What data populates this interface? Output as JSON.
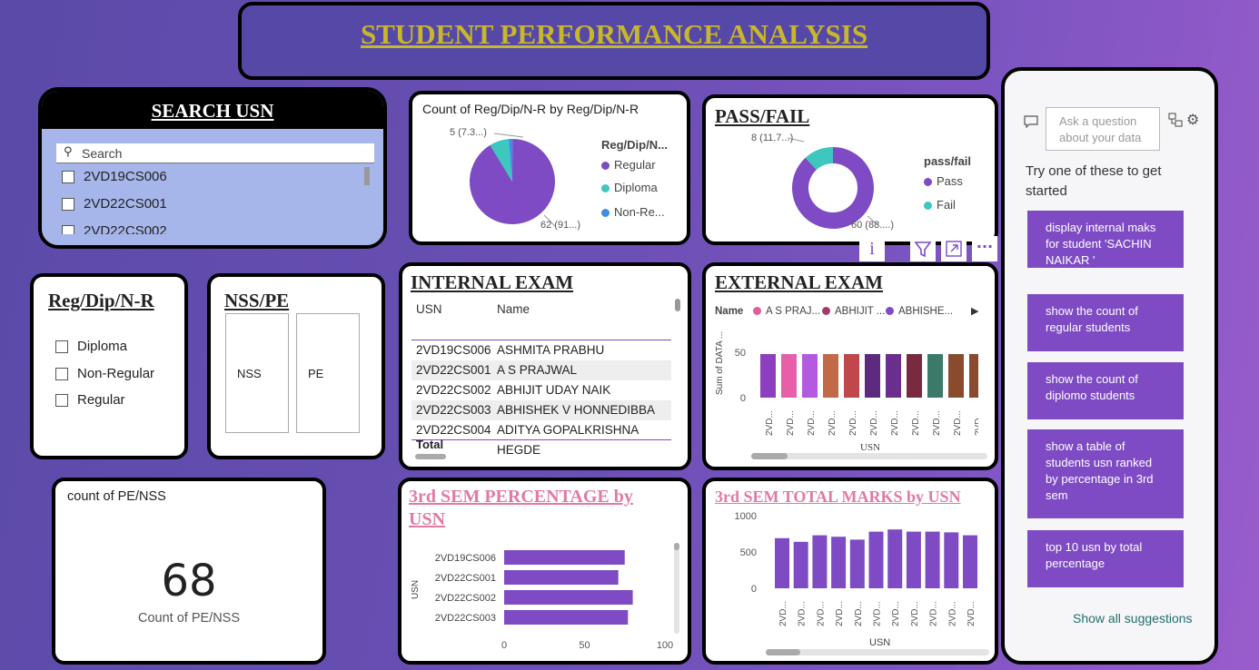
{
  "header": {
    "title": "STUDENT PERFORMANCE ANALYSIS "
  },
  "search": {
    "title": "SEARCH USN",
    "placeholder": "Search",
    "items": [
      "2VD19CS006",
      "2VD22CS001",
      "2VD22CS002"
    ]
  },
  "pie_card": {
    "title": "Count of Reg/Dip/N-R by Reg/Dip/N-R",
    "legend_title": "Reg/Dip/N...",
    "legend": [
      "Regular",
      "Diploma",
      "Non-Re..."
    ],
    "label_small": "5 (7.3...)",
    "label_big": "62 (91...)"
  },
  "passfail": {
    "title": "PASS/FAIL",
    "legend_title": "pass/fail",
    "legend": [
      "Pass",
      "Fail"
    ],
    "label_small": "8 (11.7...)",
    "label_big": "60 (88....)"
  },
  "visual_toolbar": {
    "info": "i",
    "filter": "filter",
    "focus": "focus",
    "more": "···"
  },
  "regdip": {
    "title": "Reg/Dip/N-R",
    "items": [
      "Diploma",
      "Non-Regular",
      "Regular"
    ]
  },
  "nsspe": {
    "title": "NSS/PE",
    "items": [
      "NSS",
      "PE"
    ]
  },
  "internal": {
    "title": "INTERNAL EXAM",
    "headers": [
      "USN",
      "Name"
    ],
    "rows": [
      [
        "2VD19CS006",
        "ASHMITA PRABHU"
      ],
      [
        "2VD22CS001",
        "A S PRAJWAL"
      ],
      [
        "2VD22CS002",
        "ABHIJIT UDAY NAIK"
      ],
      [
        "2VD22CS003",
        "ABHISHEK V HONNEDIBBA"
      ],
      [
        "2VD22CS004",
        "ADITYA GOPALKRISHNA HEGDE"
      ]
    ],
    "total": "Total"
  },
  "external": {
    "title": "EXTERNAL EXAM",
    "legend_title": "Name",
    "legend": [
      "A S PRAJ...",
      "ABHIJIT ...",
      "ABHISHE..."
    ],
    "ylabel": "Sum of DATA ...",
    "xlabel": "USN",
    "yticks": [
      "50",
      "0"
    ],
    "xtick": "2VD..."
  },
  "count_card": {
    "title": "count of PE/NSS",
    "value": "68",
    "caption": "Count of PE/NSS"
  },
  "sem_pct": {
    "title": "3rd SEM PERCENTAGE by USN",
    "ylabel": "USN",
    "categories": [
      "2VD19CS006",
      "2VD22CS001",
      "2VD22CS002",
      "2VD22CS003"
    ],
    "xticks": [
      "0",
      "50",
      "100"
    ]
  },
  "sem_total": {
    "title": "3rd SEM TOTAL MARKS by USN",
    "xlabel": "USN",
    "yticks": [
      "1000",
      "500",
      "0"
    ],
    "xtick": "2VD..."
  },
  "qa": {
    "placeholder": "Ask a question about your data",
    "prompt": "Try one of these to get started",
    "suggestions": [
      "display internal maks for student 'SACHIN NAIKAR '",
      "show the count of regular students",
      "show the count of diplomo students",
      "show a table of students usn ranked by percentage in 3rd sem",
      "top 10 usn by total percentage"
    ],
    "show_all": "Show all suggestions"
  },
  "colors": {
    "accent": "#7e4bc4",
    "pie": [
      "#7e4bc4",
      "#3cc7bf",
      "#3a8fe8"
    ],
    "legend_ext": [
      "#e55b9e",
      "#a33a6b",
      "#7e4bc4"
    ],
    "title_yellow": "#c8b62c",
    "title_pink": "#e27aa5"
  },
  "chart_data": [
    {
      "type": "pie",
      "title": "Count of Reg/Dip/N-R by Reg/Dip/N-R",
      "categories": [
        "Regular",
        "Diploma",
        "Non-Re..."
      ],
      "values": [
        62,
        5,
        1
      ]
    },
    {
      "type": "pie",
      "title": "PASS/FAIL",
      "categories": [
        "Pass",
        "Fail"
      ],
      "values": [
        60,
        8
      ]
    },
    {
      "type": "bar",
      "title": "EXTERNAL EXAM",
      "xlabel": "USN",
      "ylabel": "Sum of DATA ...",
      "ylim": [
        0,
        60
      ],
      "values": [
        48,
        48,
        48,
        48,
        48,
        48,
        48,
        48,
        48,
        48,
        48
      ],
      "colors": [
        "#8e3fbf",
        "#e75ea9",
        "#b35ae0",
        "#c06a48",
        "#c0484c",
        "#5e2a80",
        "#6a2e8e",
        "#7a2a40",
        "#3a7a66",
        "#8a4a2e",
        "#8a4a2e"
      ]
    },
    {
      "type": "bar",
      "title": "3rd SEM PERCENTAGE by USN",
      "categories": [
        "2VD19CS006",
        "2VD22CS001",
        "2VD22CS002",
        "2VD22CS003"
      ],
      "values": [
        75,
        71,
        80,
        77
      ],
      "xlim": [
        0,
        100
      ],
      "ylabel": "USN"
    },
    {
      "type": "bar",
      "title": "3rd SEM TOTAL MARKS by USN",
      "xlabel": "USN",
      "ylim": [
        0,
        1000
      ],
      "values": [
        690,
        640,
        730,
        710,
        670,
        780,
        810,
        780,
        780,
        770,
        730
      ]
    }
  ]
}
